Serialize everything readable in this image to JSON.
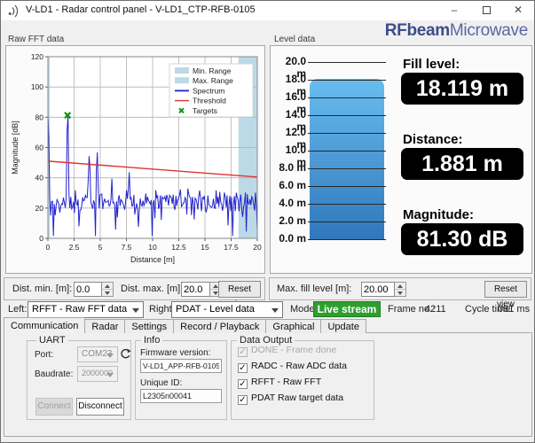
{
  "window": {
    "title": "V-LD1 - Radar control panel - V-LD1_CTP-RFB-0105",
    "controls": {
      "minimize": "–",
      "close": "✕"
    }
  },
  "logo": {
    "bold": "RFbeam",
    "light": "Microwave"
  },
  "fft_panel": {
    "title": "Raw FFT data"
  },
  "level_panel": {
    "title": "Level data",
    "gauge": {
      "min": 0,
      "max": 20,
      "step": 2,
      "unit": "m",
      "value": 18.119,
      "bar_top_color": "#68bdf0",
      "bar_bottom_color": "#3077bb"
    },
    "readouts": [
      {
        "label": "Fill level:",
        "value": "18.119 m"
      },
      {
        "label": "Distance:",
        "value": "1.881 m"
      },
      {
        "label": "Magnitude:",
        "value": "81.30 dB"
      }
    ]
  },
  "chart_data": {
    "type": "line",
    "title": "Raw FFT data",
    "xlabel": "Distance [m]",
    "ylabel": "Magnitude [dB]",
    "xlim": [
      0,
      20
    ],
    "ylim": [
      0,
      120
    ],
    "xticks": [
      "0",
      "2.5",
      "5",
      "7.5",
      "10",
      "12.5",
      "15",
      "17.5",
      "20"
    ],
    "yticks": [
      0,
      20,
      40,
      60,
      80,
      100,
      120
    ],
    "legend": [
      "Min. Range",
      "Max. Range",
      "Spectrum",
      "Threshold",
      "Targets"
    ],
    "min_range_band": [
      0,
      0.18
    ],
    "max_range_band": [
      18.2,
      20
    ],
    "threshold": {
      "x": [
        0,
        20
      ],
      "y": [
        51,
        40.5
      ]
    },
    "targets": [
      {
        "x": 1.881,
        "y": 81.3
      }
    ],
    "spectrum_peaks": [
      {
        "x": 0.02,
        "y": 83,
        "w": 0.1
      },
      {
        "x": 1.881,
        "y": 81.3,
        "w": 0.09
      },
      {
        "x": 3.95,
        "y": 55,
        "w": 0.12
      },
      {
        "x": 4.7,
        "y": 57.5,
        "w": 0.1
      },
      {
        "x": 6.1,
        "y": 40,
        "w": 0.08
      },
      {
        "x": 7.75,
        "y": 45.5,
        "w": 0.08
      },
      {
        "x": 13.4,
        "y": 38,
        "w": 0.07
      },
      {
        "x": 16.1,
        "y": 36,
        "w": 0.06
      }
    ],
    "noise": {
      "mean": 24,
      "amplitude": 9,
      "seed": 12,
      "points": 230
    },
    "dips": [
      0.55,
      4.5,
      9.95,
      17.6
    ],
    "colors": {
      "band": "#bcd9e7",
      "spectrum": "#2222cc",
      "threshold": "#e03232",
      "target": "#0c960c",
      "grid": "#b2b2b2",
      "frame": "#8a8a8a"
    }
  },
  "fft_controls": {
    "dist_min_label": "Dist. min. [m]:",
    "dist_min_value": "0.0",
    "dist_max_label": "Dist. max. [m]:",
    "dist_max_value": "20.0",
    "reset_label": "Reset view"
  },
  "level_controls": {
    "max_fill_label": "Max. fill level [m]:",
    "max_fill_value": "20.00",
    "reset_label": "Reset view"
  },
  "selector_row": {
    "left_label": "Left:",
    "left_value": "RFFT - Raw FFT data",
    "right_label": "Right:",
    "right_value": "PDAT - Level data",
    "mode_label": "Mode:",
    "mode_value": "Live stream",
    "mode_color": "#2f9e2f",
    "frame_label": "Frame no.:",
    "frame_value": "4211",
    "cycle_label": "Cycle time:",
    "cycle_value": "081 ms"
  },
  "tabs": {
    "items": [
      "Communication",
      "Radar",
      "Settings",
      "Record / Playback",
      "Graphical",
      "Update"
    ],
    "active": 0
  },
  "uart": {
    "title": "UART",
    "port_label": "Port:",
    "port_value": "COM23",
    "baud_label": "Baudrate:",
    "baud_value": "2000000",
    "connect_label": "Connect",
    "disconnect_label": "Disconnect"
  },
  "info": {
    "title": "Info",
    "fw_label": "Firmware version:",
    "fw_value": "V-LD1_APP-RFB-0105",
    "uid_label": "Unique ID:",
    "uid_value": "L2305n00041"
  },
  "data_output": {
    "title": "Data Output",
    "checkboxes": [
      {
        "label": "DONE - Frame done",
        "checked": true,
        "enabled": false
      },
      {
        "label": "RADC - Raw ADC data",
        "checked": true,
        "enabled": true
      },
      {
        "label": "RFFT - Raw FFT",
        "checked": true,
        "enabled": true
      },
      {
        "label": "PDAT  Raw target data",
        "checked": true,
        "enabled": true
      }
    ]
  }
}
